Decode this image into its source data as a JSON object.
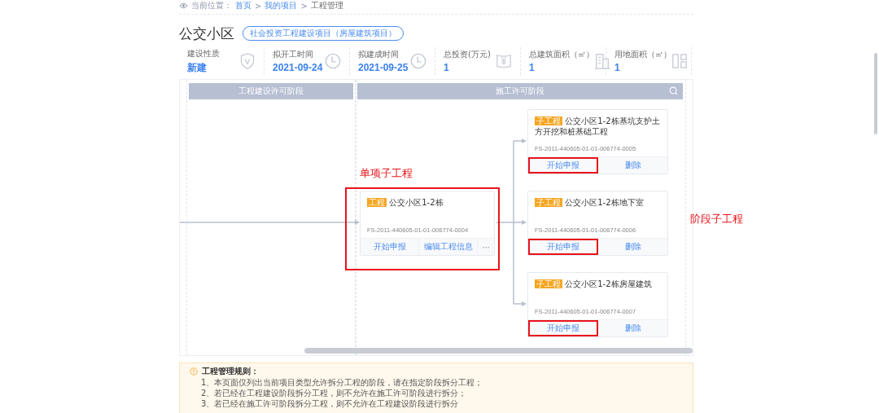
{
  "breadcrumb": {
    "label": "当前位置：",
    "separator": ">",
    "items": [
      "首页",
      "我的项目",
      "工程管理"
    ]
  },
  "project": {
    "name": "公交小区",
    "type_tag": "社会投资工程建设项目（房屋建筑项目）"
  },
  "stats": [
    {
      "label": "建设性质",
      "value": "新建",
      "kind": "shield"
    },
    {
      "label": "拟开工时间",
      "value": "2021-09-24",
      "kind": "clock"
    },
    {
      "label": "拟建成时间",
      "value": "2021-09-25",
      "kind": "clock"
    },
    {
      "label": "总投资(万元)",
      "value": "1",
      "kind": "money"
    },
    {
      "label": "总建筑面积（㎡）",
      "value": "1",
      "kind": "building"
    },
    {
      "label": "用地面积（㎡）",
      "value": "1",
      "kind": "plot"
    }
  ],
  "stages": [
    {
      "title": "工程建设许可阶段",
      "search": false
    },
    {
      "title": "施工许可阶段",
      "search": true
    }
  ],
  "main_project": {
    "tag": "工程",
    "name": "公交小区1-2栋",
    "code": "FS-2011-440605-01-01-006774-0004",
    "highlighted": true,
    "actions": [
      {
        "label": "开始申报",
        "highlighted": false
      },
      {
        "label": "编辑工程信息",
        "highlighted": false
      },
      {
        "label": "···",
        "highlighted": false
      }
    ]
  },
  "sub_projects": [
    {
      "tag": "子工程",
      "name": "公交小区1-2栋基坑支护土方开挖和桩基础工程",
      "code": "FS-2011-440605-01-01-006774-0005",
      "actions": [
        {
          "label": "开始申报",
          "highlighted": true
        },
        {
          "label": "删除",
          "highlighted": false
        }
      ]
    },
    {
      "tag": "子工程",
      "name": "公交小区1-2栋地下室",
      "code": "FS-2011-440605-01-01-006774-0006",
      "actions": [
        {
          "label": "开始申报",
          "highlighted": true
        },
        {
          "label": "删除",
          "highlighted": false
        }
      ]
    },
    {
      "tag": "子工程",
      "name": "公交小区1-2栋房屋建筑",
      "code": "FS-2011-440605-01-01-006774-0007",
      "actions": [
        {
          "label": "开始申报",
          "highlighted": true
        },
        {
          "label": "删除",
          "highlighted": false
        }
      ]
    }
  ],
  "annotations": [
    {
      "text": "单项子工程"
    },
    {
      "text": "阶段子工程"
    }
  ],
  "rules": {
    "title": "工程管理规则：",
    "items": [
      "1、本页面仅列出当前项目类型允许拆分工程的阶段，请在指定阶段拆分工程；",
      "2、若已经在工程建设阶段拆分工程，则不允许在施工许可阶段进行拆分；",
      "3、若已经在施工许可阶段拆分工程，则不允许在工程建设阶段进行拆分"
    ]
  }
}
